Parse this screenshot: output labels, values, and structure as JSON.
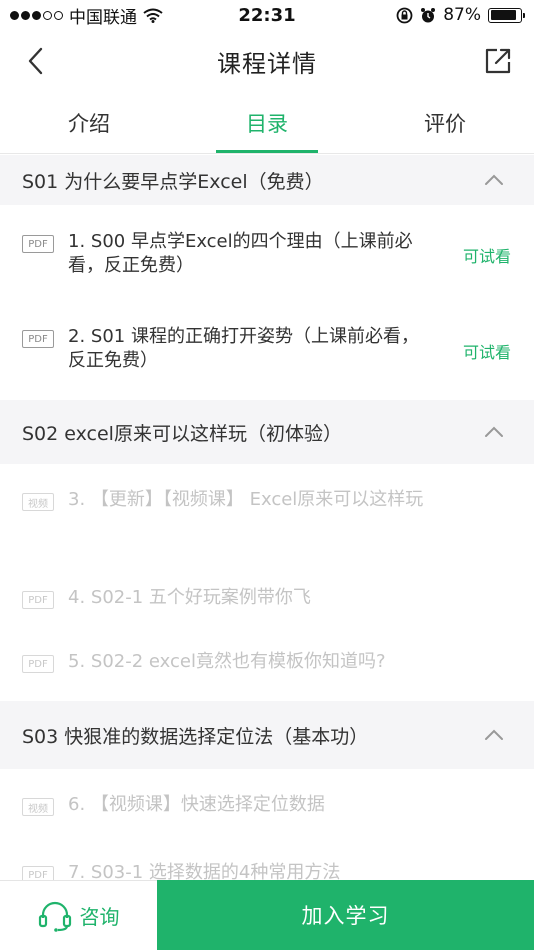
{
  "status_bar": {
    "carrier": "中国联通",
    "time": "22:31",
    "battery_percent": "87%",
    "battery_level": 0.87,
    "signal_dots_filled": 3,
    "signal_dots_total": 5
  },
  "nav": {
    "title": "课程详情",
    "back_icon": "chevron-left-icon",
    "share_icon": "share-external-icon"
  },
  "tabs": [
    {
      "label": "介绍",
      "active": false
    },
    {
      "label": "目录",
      "active": true
    },
    {
      "label": "评价",
      "active": false
    }
  ],
  "sections": [
    {
      "title": "S01 为什么要早点学Excel（免费）",
      "lessons": [
        {
          "badge": "PDF",
          "title": "1. S00 早点学Excel的四个理由（上课前必看，反正免费）",
          "trial": "可试看",
          "locked": false
        },
        {
          "badge": "PDF",
          "title": "2. S01 课程的正确打开姿势（上课前必看，反正免费）",
          "trial": "可试看",
          "locked": false
        }
      ]
    },
    {
      "title": "S02 excel原来可以这样玩（初体验）",
      "lessons": [
        {
          "badge": "视频",
          "title": "3. 【更新】【视频课】 Excel原来可以这样玩",
          "trial": "",
          "locked": true
        },
        {
          "badge": "PDF",
          "title": "4. S02-1 五个好玩案例带你飞",
          "trial": "",
          "locked": true
        },
        {
          "badge": "PDF",
          "title": "5. S02-2 excel竟然也有模板你知道吗?",
          "trial": "",
          "locked": true
        }
      ]
    },
    {
      "title": "S03 快狠准的数据选择定位法（基本功）",
      "lessons": [
        {
          "badge": "视频",
          "title": "6. 【视频课】快速选择定位数据",
          "trial": "",
          "locked": true
        },
        {
          "badge": "PDF",
          "title": "7. S03-1 选择数据的4种常用方法",
          "trial": "",
          "locked": true
        }
      ]
    }
  ],
  "bottom_bar": {
    "consult_label": "咨询",
    "consult_icon": "headset-icon",
    "join_label": "加入学习"
  },
  "colors": {
    "accent": "#1fb36b",
    "section_bg": "#f5f5f7",
    "locked_text": "#c4c4c4"
  }
}
